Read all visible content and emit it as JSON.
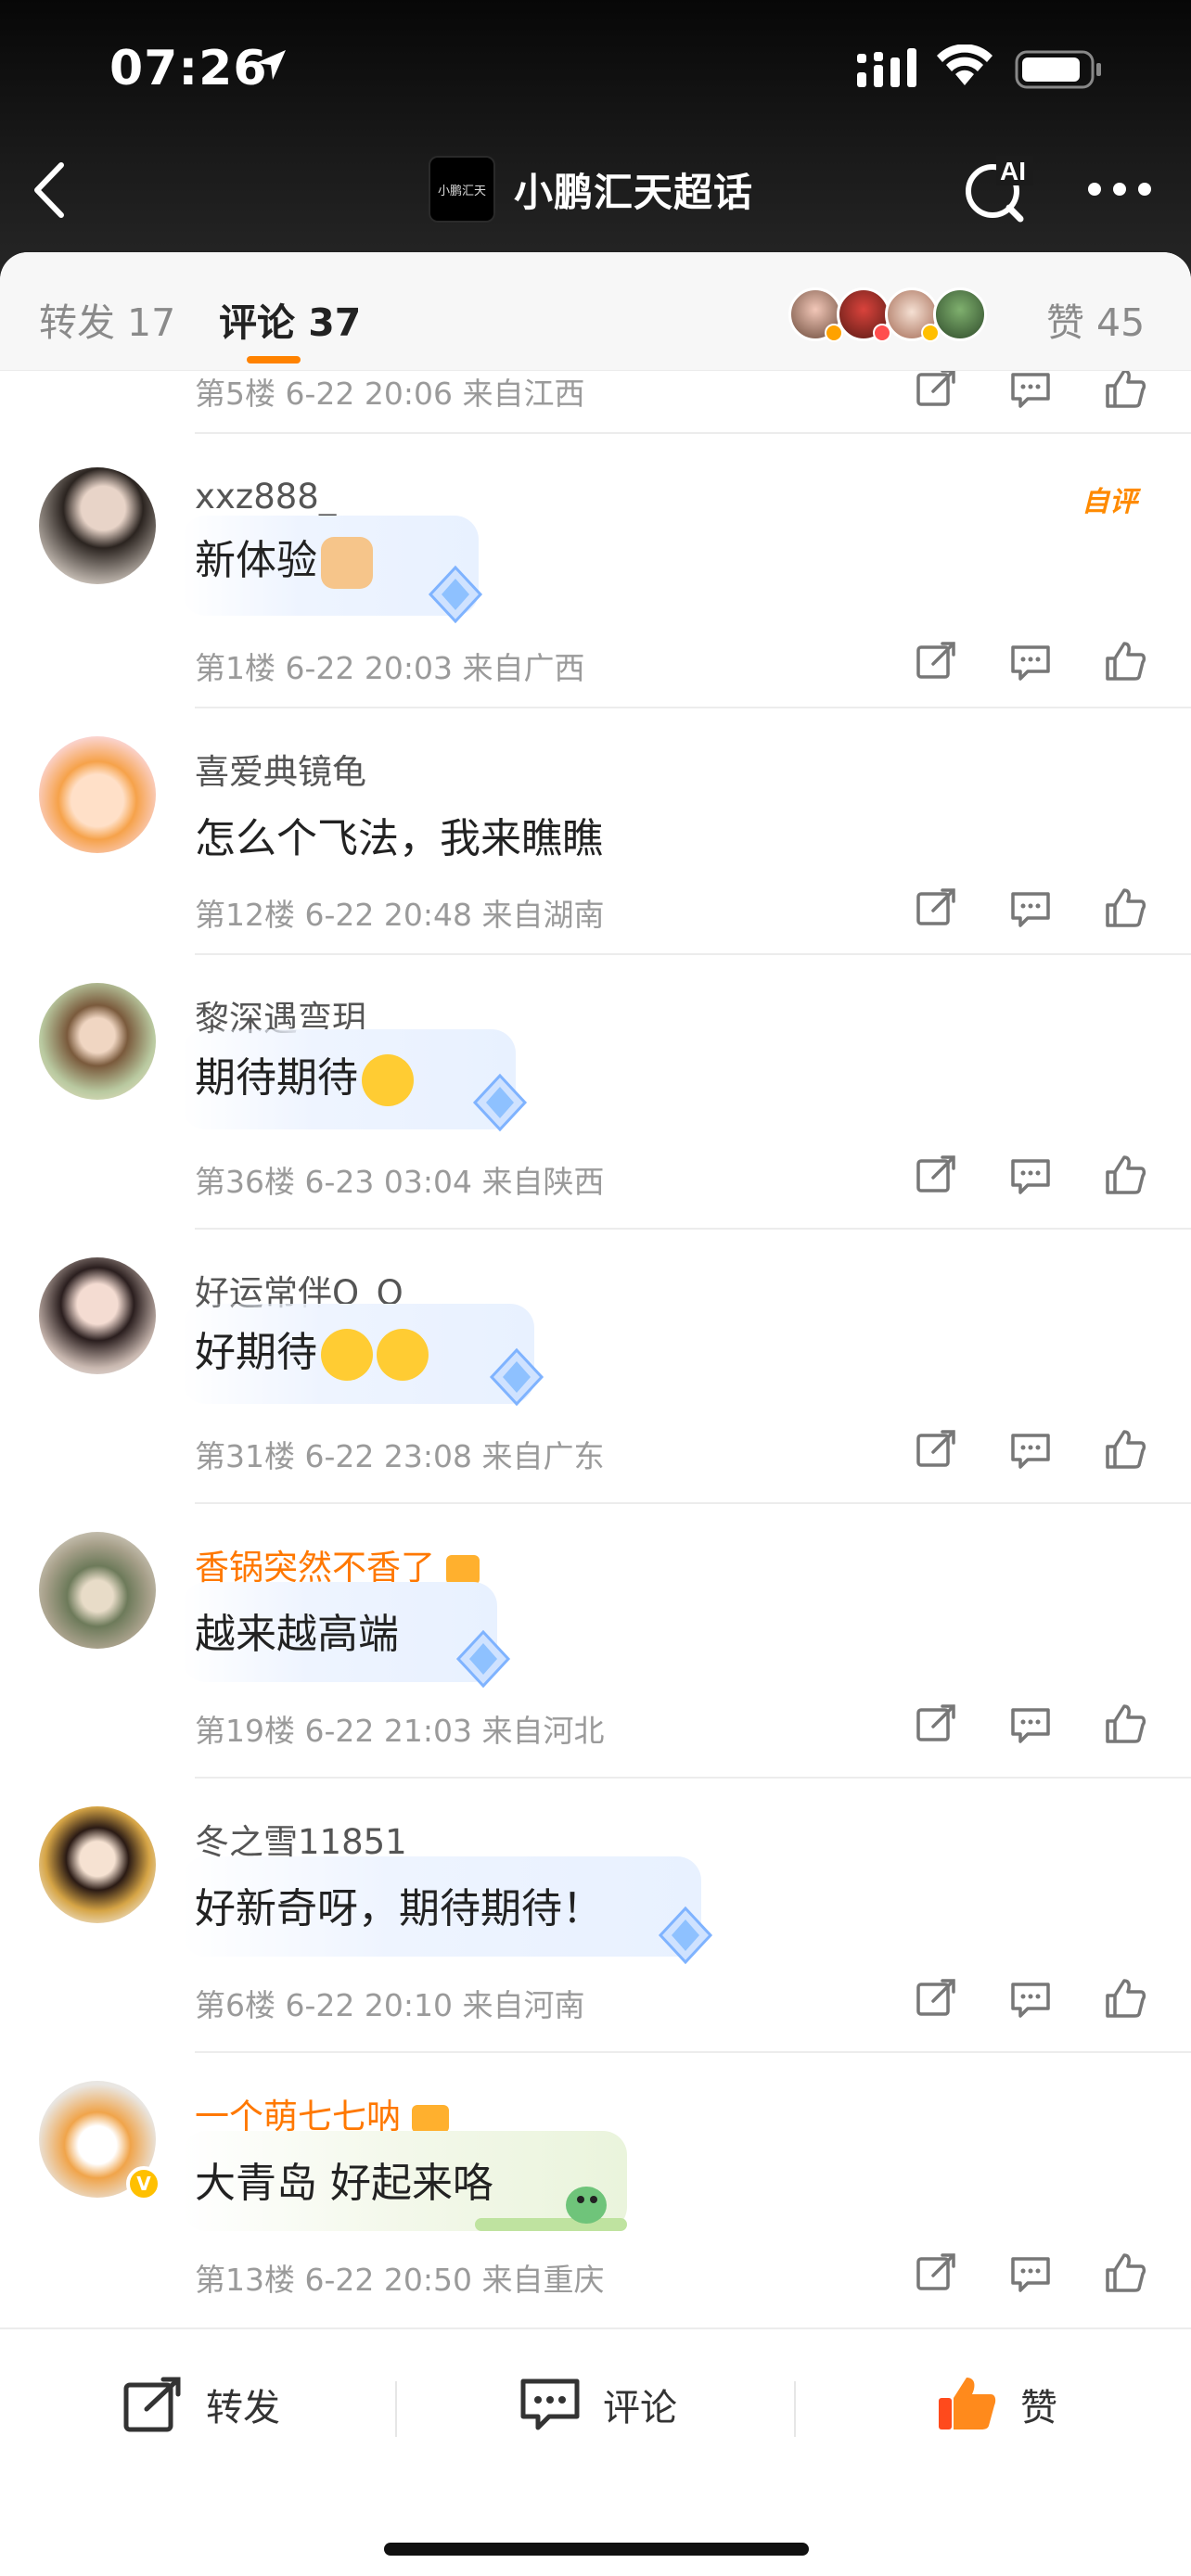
{
  "status_bar": {
    "time": "07:26"
  },
  "header": {
    "logo_text": "小鹏汇天",
    "title": "小鹏汇天超话",
    "ai_label": "AI"
  },
  "tabs": {
    "repost_label": "转发",
    "repost_count": "17",
    "comment_label": "评论",
    "comment_count": "37",
    "like_label": "赞",
    "like_count": "45"
  },
  "colors": {
    "accent": "#ff8200",
    "vip_name": "#ff7800",
    "verified_badge": "#ffc000"
  },
  "comments": [
    {
      "meta": "第5楼 6-22 20:06 来自江西"
    },
    {
      "username": "xxz888_",
      "text": "新体验",
      "emoji": "thumbs-up",
      "self_tag": "自评",
      "meta": "第1楼 6-22 20:03 来自广西"
    },
    {
      "username": "喜爱典镜龟",
      "text": "怎么个飞法，我来瞧瞧",
      "meta": "第12楼 6-22 20:48 来自湖南"
    },
    {
      "username": "黎深遇弯玥",
      "text": "期待期待",
      "emoji": "excited-face",
      "meta": "第36楼 6-23 03:04 来自陕西"
    },
    {
      "username": "好运常伴Q_Q",
      "text": "好期待",
      "emoji": "flower-face x2",
      "meta": "第31楼 6-22 23:08 来自广东"
    },
    {
      "username": "香锅突然不香了",
      "text": "越来越高端",
      "meta": "第19楼 6-22 21:03 来自河北"
    },
    {
      "username": "冬之雪11851",
      "text": "好新奇呀，期待期待！",
      "meta": "第6楼 6-22 20:10 来自河南"
    },
    {
      "username": "一个萌七七呐",
      "text": "大青岛  好起来咯",
      "meta": "第13楼 6-22 20:50 来自重庆"
    }
  ],
  "bottom_bar": {
    "repost_label": "转发",
    "comment_label": "评论",
    "like_label": "赞"
  },
  "icons": [
    "location-arrow-icon",
    "signal-icon",
    "wifi-icon",
    "battery-icon",
    "back-icon",
    "ai-search-icon",
    "more-icon",
    "share-icon",
    "reply-icon",
    "like-icon",
    "diamond-icon"
  ]
}
